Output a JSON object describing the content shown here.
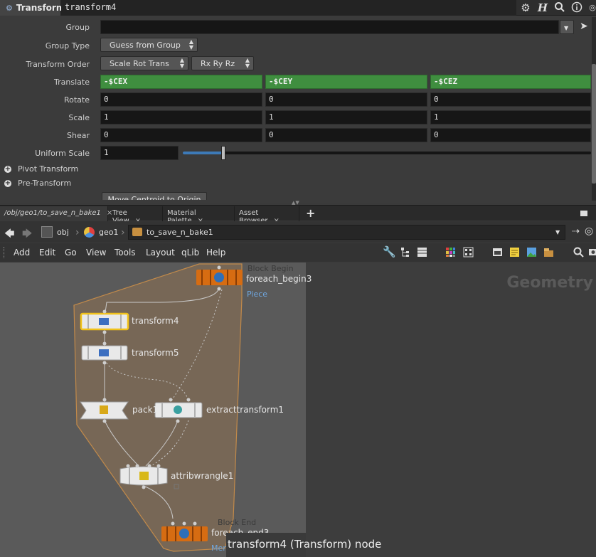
{
  "param_pane": {
    "node_type": "Transform",
    "node_name": "transform4",
    "header_icons": [
      "gear-icon",
      "help-icon",
      "search-icon",
      "info-icon"
    ],
    "params": {
      "group": {
        "label": "Group",
        "value": ""
      },
      "group_type": {
        "label": "Group Type",
        "value": "Guess from Group"
      },
      "transform_order": {
        "label": "Transform Order",
        "value": "Scale Rot Trans",
        "rot_order": "Rx Ry Rz"
      },
      "translate": {
        "label": "Translate",
        "x": "-$CEX",
        "y": "-$CEY",
        "z": "-$CEZ"
      },
      "rotate": {
        "label": "Rotate",
        "x": "0",
        "y": "0",
        "z": "0"
      },
      "scale": {
        "label": "Scale",
        "x": "1",
        "y": "1",
        "z": "1"
      },
      "shear": {
        "label": "Shear",
        "x": "0",
        "y": "0",
        "z": "0"
      },
      "uniform_scale": {
        "label": "Uniform Scale",
        "value": "1",
        "slider_fraction": 0.1
      }
    },
    "folders": [
      "Pivot Transform",
      "Pre-Transform"
    ],
    "button_label": "Move Centroid to Origin",
    "expression_color": "#3f8e3f"
  },
  "tabs": [
    {
      "label": "/obj/geo1/to_save_n_bake1",
      "close": "×"
    },
    {
      "label": "Tree View",
      "close": "×"
    },
    {
      "label": "Material Palette",
      "close": "×"
    },
    {
      "label": "Asset Browser",
      "close": "×"
    }
  ],
  "add_tab": "+",
  "path": {
    "obj": "obj",
    "geo": "geo1",
    "subnet": "to_save_n_bake1"
  },
  "menu": [
    "Add",
    "Edit",
    "Go",
    "View",
    "Tools",
    "Layout",
    "qLib",
    "Help"
  ],
  "network": {
    "context_label": "Geometry",
    "block_color": "#c28a4a",
    "nodes": {
      "foreach_begin": {
        "name": "foreach_begin3",
        "sub": "Piece",
        "block_label": "Block Begin"
      },
      "transform4": {
        "name": "transform4"
      },
      "transform5": {
        "name": "transform5"
      },
      "pack": {
        "name": "pack1"
      },
      "extract": {
        "name": "extracttransform1"
      },
      "wrangle": {
        "name": "attribwrangle1"
      },
      "foreach_end": {
        "name": "foreach_end3",
        "sub": "Merge",
        "block_label": "Block End"
      }
    },
    "status": "transform4 (Transform) node"
  }
}
